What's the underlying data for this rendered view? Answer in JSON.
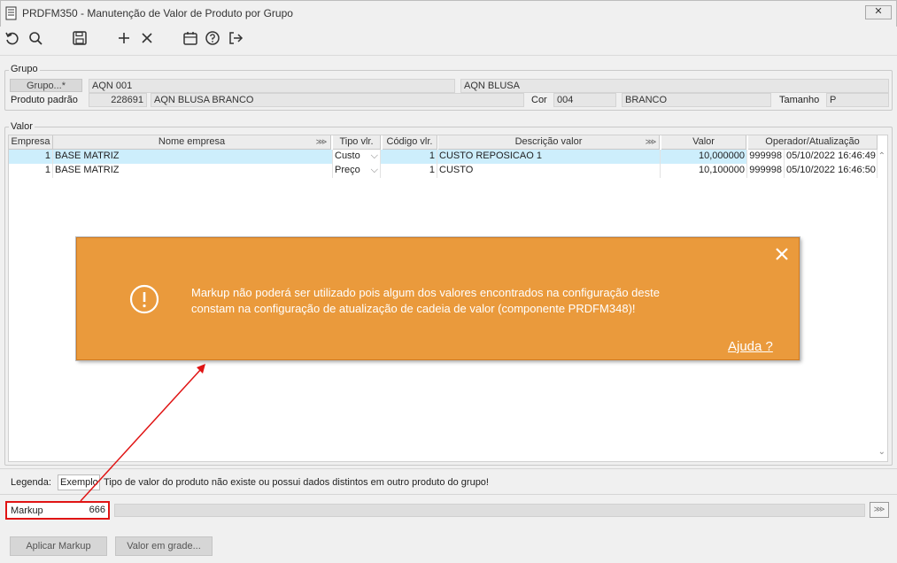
{
  "window": {
    "title": "PRDFM350 - Manutenção de Valor de Produto por Grupo",
    "close_label": "✕"
  },
  "toolbar": {
    "icons": [
      "undo-icon",
      "search-icon",
      "save-icon",
      "add-icon",
      "delete-icon",
      "calendar-icon",
      "help-icon",
      "exit-icon"
    ]
  },
  "grupo": {
    "legend": "Grupo",
    "grupo_button": "Grupo...*",
    "grupo_code": "AQN 001",
    "grupo_desc": "AQN BLUSA",
    "produto_label": "Produto padrão",
    "produto_code": "228691",
    "produto_desc": "AQN BLUSA BRANCO",
    "cor_label": "Cor",
    "cor_code": "004",
    "cor_desc": "BRANCO",
    "tamanho_label": "Tamanho",
    "tamanho_value": "P"
  },
  "valor": {
    "legend": "Valor",
    "columns": [
      "Empresa",
      "Nome empresa",
      "Tipo vlr.",
      "Código vlr.",
      "Descrição valor",
      "Valor",
      "Operador/Atualização"
    ],
    "rows": [
      {
        "empresa": "1",
        "nome": "BASE MATRIZ",
        "tipo": "Custo",
        "codigo": "1",
        "descricao": "CUSTO REPOSICAO 1",
        "valor": "10,000000",
        "operador": "999998",
        "atualizacao": "05/10/2022 16:46:49"
      },
      {
        "empresa": "1",
        "nome": "BASE MATRIZ",
        "tipo": "Preço",
        "codigo": "1",
        "descricao": "CUSTO",
        "valor": "10,100000",
        "operador": "999998",
        "atualizacao": "05/10/2022 16:46:50"
      }
    ]
  },
  "toast": {
    "message_line1": "Markup não poderá ser utilizado pois algum dos valores encontrados na configuração deste",
    "message_line2": "constam na configuração de atualização de cadeia de valor (componente PRDFM348)!",
    "help_link": "Ajuda ?",
    "close_label": "✕"
  },
  "legenda": {
    "label": "Legenda:",
    "example": "Exemplo",
    "description": "Tipo de valor do produto não existe ou possui dados distintos em outro produto do grupo!"
  },
  "markup": {
    "label": "Markup",
    "value": "666"
  },
  "buttons": {
    "aplicar": "Aplicar Markup",
    "valor_grade": "Valor em grade..."
  },
  "colors": {
    "toast_bg": "#ea9a3c",
    "selected_row": "#cdeefc",
    "highlight_red": "#e01414"
  }
}
